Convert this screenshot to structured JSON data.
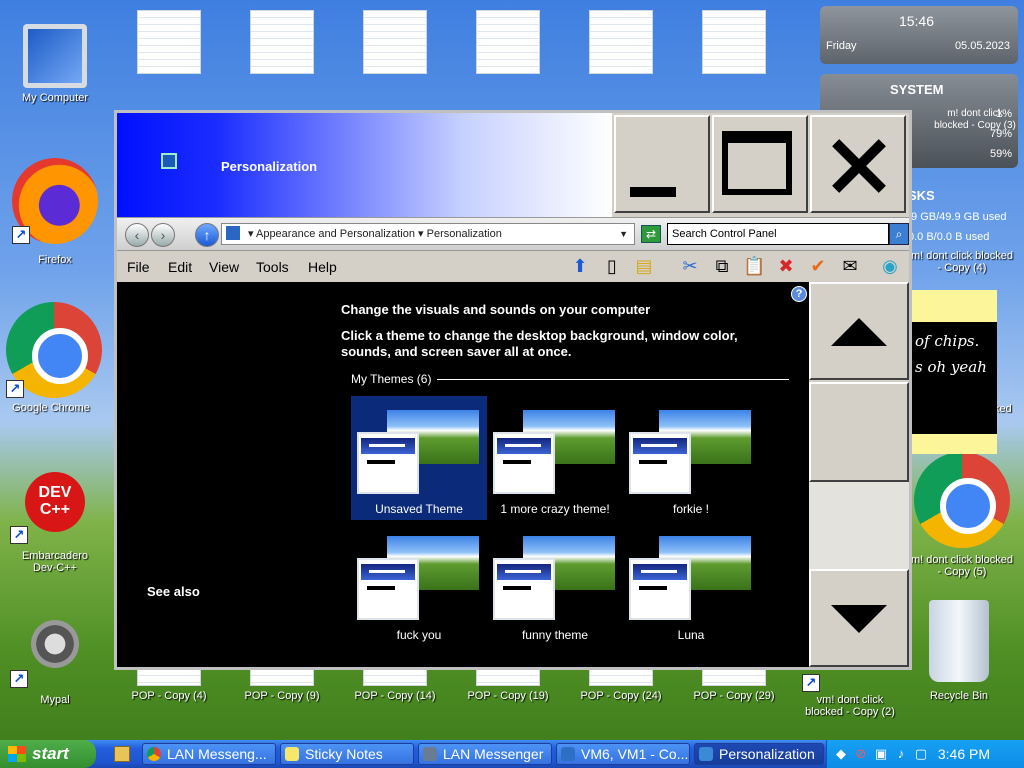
{
  "desktop": {
    "icons_left": [
      {
        "label": "My Computer",
        "icon": "computer-icon"
      },
      {
        "label": "Firefox",
        "icon": "firefox-icon"
      },
      {
        "label": "Google Chrome",
        "icon": "chrome-icon"
      },
      {
        "label": "Embarcadero Dev-C++",
        "icon": "devcpp-icon"
      },
      {
        "label": "Mypal",
        "icon": "mypal-icon"
      }
    ],
    "icons_bottom": [
      {
        "label": "POP - Copy (4)"
      },
      {
        "label": "POP - Copy (9)"
      },
      {
        "label": "POP - Copy (14)"
      },
      {
        "label": "POP - Copy (19)"
      },
      {
        "label": "POP - Copy (24)"
      },
      {
        "label": "POP - Copy (29)"
      },
      {
        "label": "vm! dont click blocked - Copy (2)"
      },
      {
        "label": "Recycle Bin"
      }
    ],
    "icons_right": [
      {
        "label": "m! dont click blocked - Copy (4)"
      },
      {
        "label": "m! dont click blocked - Copy (5)"
      },
      {
        "label": "ked"
      }
    ]
  },
  "gadgets": {
    "clock": {
      "time": "15:46",
      "day": "Friday",
      "date": "05.05.2023"
    },
    "system": {
      "title": "SYSTEM",
      "stats": [
        "1%",
        "79%",
        "59%"
      ],
      "overlay_text": "m! dont click blocked - Copy (3)"
    },
    "disks": {
      "title": "SKS",
      "line1": ".9 GB/49.9 GB used",
      "line2": "0.0 B/0.0 B used"
    },
    "sticky": {
      "line1": "of chips.",
      "line2": "s oh yeah"
    }
  },
  "window": {
    "title": "Personalization",
    "address": {
      "crumb1": "Appearance and Personalization",
      "crumb2": "Personalization"
    },
    "search_value": "Search Control Panel",
    "menu": [
      "File",
      "Edit",
      "View",
      "Tools",
      "Help"
    ],
    "content": {
      "heading": "Change the visuals and sounds on your computer",
      "subheading": "Click a theme to change the desktop background, window color, sounds, and screen saver all at once.",
      "group_label": "My Themes (6)",
      "themes": [
        {
          "name": "Unsaved Theme",
          "selected": true
        },
        {
          "name": "1 more crazy theme!",
          "selected": false
        },
        {
          "name": "forkie !",
          "selected": false
        },
        {
          "name": "fuck you",
          "selected": false
        },
        {
          "name": "funny theme",
          "selected": false
        },
        {
          "name": "Luna",
          "selected": false
        }
      ],
      "see_also": "See also"
    }
  },
  "taskbar": {
    "start": "start",
    "buttons": [
      {
        "label": "LAN Messeng...",
        "icon": "chrome-icon"
      },
      {
        "label": "Sticky Notes",
        "icon": "sticky-notes-icon"
      },
      {
        "label": "LAN Messenger",
        "icon": "lan-messenger-icon"
      },
      {
        "label": "VM6, VM1 - Co...",
        "icon": "vm-icon"
      },
      {
        "label": "Personalization",
        "icon": "personalization-icon",
        "active": true
      }
    ],
    "clock": "3:46 PM"
  }
}
